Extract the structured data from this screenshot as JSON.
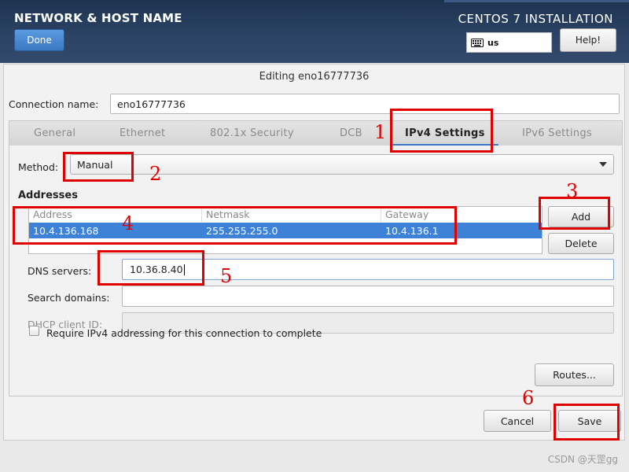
{
  "header": {
    "title": "NETWORK & HOST NAME",
    "done_label": "Done",
    "install_title": "CENTOS 7 INSTALLATION",
    "keyboard_layout": "us",
    "help_label": "Help!"
  },
  "dialog": {
    "title": "Editing eno16777736",
    "connection_name_label": "Connection name:",
    "connection_name_value": "eno16777736",
    "tabs": [
      {
        "label": "General",
        "active": false
      },
      {
        "label": "Ethernet",
        "active": false
      },
      {
        "label": "802.1x Security",
        "active": false
      },
      {
        "label": "DCB",
        "active": false
      },
      {
        "label": "IPv4 Settings",
        "active": true
      },
      {
        "label": "IPv6 Settings",
        "active": false
      }
    ],
    "ipv4": {
      "method_label": "Method:",
      "method_value": "Manual",
      "addresses_label": "Addresses",
      "columns": [
        "Address",
        "Netmask",
        "Gateway"
      ],
      "rows": [
        {
          "address": "10.4.136.168",
          "netmask": "255.255.255.0",
          "gateway": "10.4.136.1"
        }
      ],
      "add_label": "Add",
      "delete_label": "Delete",
      "dns_label": "DNS servers:",
      "dns_value": "10.36.8.40",
      "search_label": "Search domains:",
      "search_value": "",
      "dhcp_label": "DHCP client ID:",
      "dhcp_value": "",
      "require_label": "Require IPv4 addressing for this connection to complete",
      "require_checked": false,
      "routes_label": "Routes..."
    },
    "cancel_label": "Cancel",
    "save_label": "Save"
  },
  "annotations": [
    "1",
    "2",
    "3",
    "4",
    "5",
    "6"
  ],
  "annotation_color": "#e00000",
  "accent_color": "#3d82d6",
  "watermark": "CSDN @天罡gg"
}
